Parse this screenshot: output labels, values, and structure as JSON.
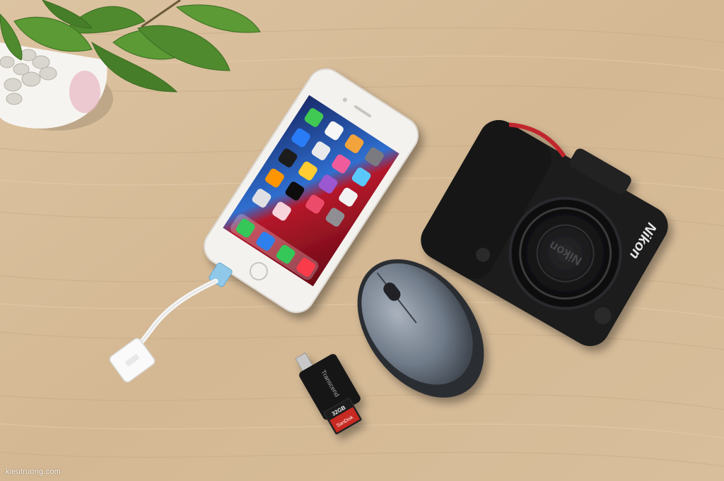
{
  "photo": {
    "watermark": "kieutruong.com",
    "camera_brand": "Nikon",
    "camera_cap_brand": "Nikon",
    "card_brand": "SanDisk",
    "card_capacity": "32GB",
    "reader_brand": "Transcend",
    "colors": {
      "wood": "#d9bf9c",
      "phone_case": "#f4f2ef",
      "camera_body": "#1c1c1e",
      "camera_accent": "#c1272d",
      "mouse_top": "#7c8694",
      "leaf": "#4f8b2e",
      "adapter_accent": "#8fc8e8"
    }
  }
}
